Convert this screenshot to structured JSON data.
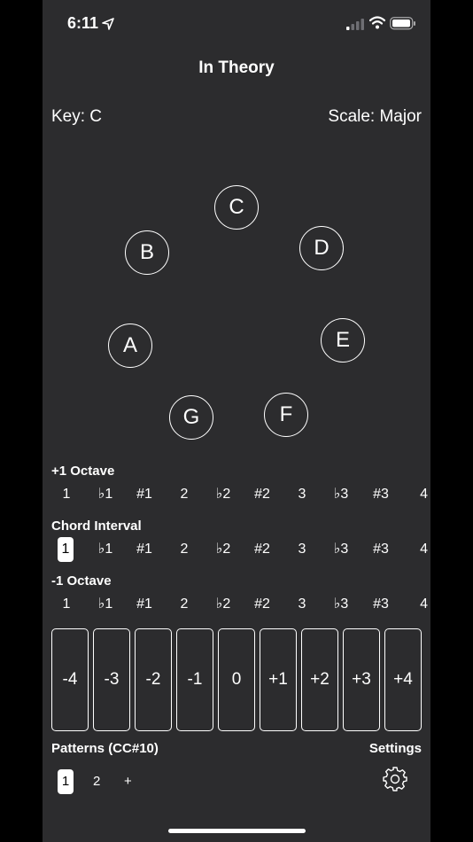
{
  "status": {
    "time": "6:11"
  },
  "title": "In Theory",
  "key_label": "Key: C",
  "scale_label": "Scale: Major",
  "notes": [
    "C",
    "D",
    "E",
    "F",
    "G",
    "A",
    "B"
  ],
  "rows": {
    "plus_octave_label": "+1 Octave",
    "chord_interval_label": "Chord Interval",
    "minus_octave_label": "-1 Octave",
    "intervals": [
      "1",
      "♭1",
      "#1",
      "2",
      "♭2",
      "#2",
      "3",
      "♭3",
      "#3",
      "4"
    ],
    "selected_chord_interval": "1"
  },
  "transpose_buttons": [
    "-4",
    "-3",
    "-2",
    "-1",
    "0",
    "+1",
    "+2",
    "+3",
    "+4"
  ],
  "patterns": {
    "label": "Patterns (CC#10)",
    "items": [
      "1",
      "2",
      "+"
    ],
    "selected": "1"
  },
  "settings_label": "Settings",
  "colors": {
    "background": "#2c2c2e",
    "foreground": "#ffffff"
  }
}
